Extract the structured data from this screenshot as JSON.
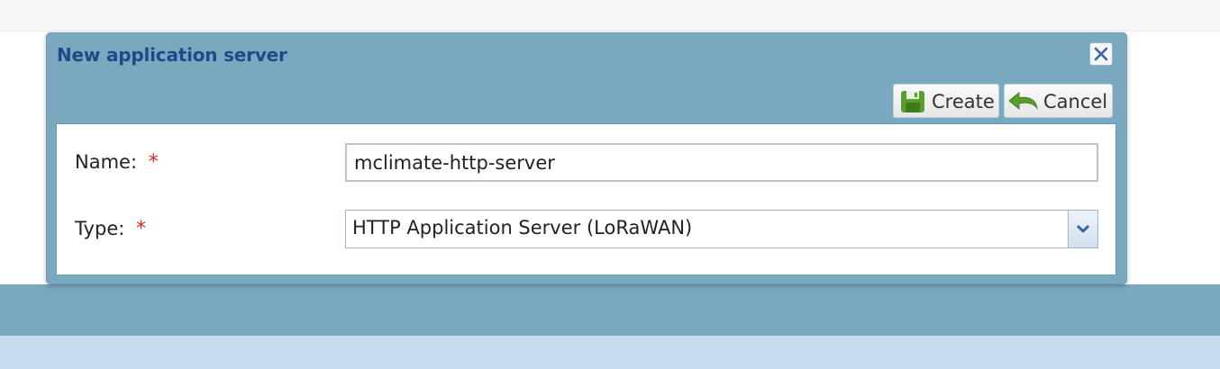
{
  "dialog": {
    "title": "New application server",
    "close_icon": "close-icon",
    "toolbar": {
      "create": {
        "label": "Create",
        "icon": "save-disk-icon",
        "icon_color": "#5a9e2f"
      },
      "cancel": {
        "label": "Cancel",
        "icon": "undo-arrow-icon",
        "icon_color": "#5a9e2f"
      }
    },
    "form": {
      "name": {
        "label": "Name:",
        "required_marker": "*",
        "value": "mclimate-http-server"
      },
      "type": {
        "label": "Type:",
        "required_marker": "*",
        "selected": "HTTP Application Server (LoRaWAN)",
        "dropdown_icon": "chevron-down-icon"
      }
    }
  },
  "colors": {
    "dialog_bg": "#79a8bf",
    "title": "#1e4a8a",
    "required": "#d9271e",
    "bottom_strip": "#c8dbee"
  }
}
